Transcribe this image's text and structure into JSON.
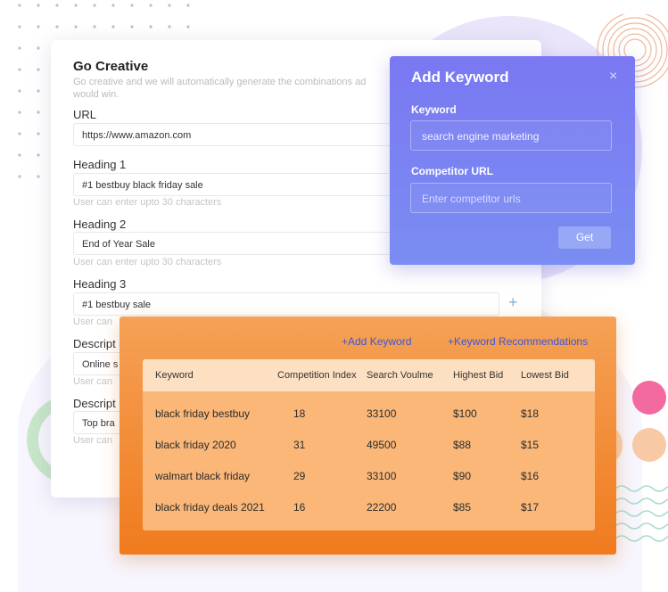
{
  "main_card": {
    "title": "Go Creative",
    "subtitle": "Go creative and we will automatically generate the combinations ad would win.",
    "url_label": "URL",
    "url_value": "https://www.amazon.com",
    "heading1_label": "Heading 1",
    "heading1_value": "#1 bestbuy black friday sale",
    "heading1_hint": "User can enter upto 30 characters",
    "heading2_label": "Heading 2",
    "heading2_value": "End of Year Sale",
    "heading2_hint": "User can enter upto 30 characters",
    "heading3_label": "Heading 3",
    "heading3_value": "#1 bestbuy sale",
    "heading3_hint": "User can",
    "plus_icon": "+",
    "desc1_label": "Descript",
    "desc1_value": "Online s",
    "desc1_hint": "User can",
    "desc2_label": "Descript",
    "desc2_value": "Top bra",
    "desc2_hint": "User can"
  },
  "add_keyword": {
    "title": "Add Keyword",
    "close_icon": "×",
    "keyword_label": "Keyword",
    "keyword_value": "search engine marketing",
    "competitor_label": "Competitor URL",
    "competitor_placeholder": "Enter competitor urls",
    "get_button": "Get"
  },
  "keywords_panel": {
    "add_keyword_link": "+Add Keyword",
    "recommendations_link": "+Keyword Recommendations",
    "columns": [
      "Keyword",
      "Competition Index",
      "Search Voulme",
      "Highest Bid",
      "Lowest Bid"
    ],
    "rows": [
      [
        "black friday bestbuy",
        "18",
        "33100",
        "$100",
        "$18"
      ],
      [
        "black friday 2020",
        "31",
        "49500",
        "$88",
        "$15"
      ],
      [
        "walmart black friday",
        "29",
        "33100",
        "$90",
        "$16"
      ],
      [
        "black friday deals 2021",
        "16",
        "22200",
        "$85",
        "$17"
      ]
    ]
  }
}
